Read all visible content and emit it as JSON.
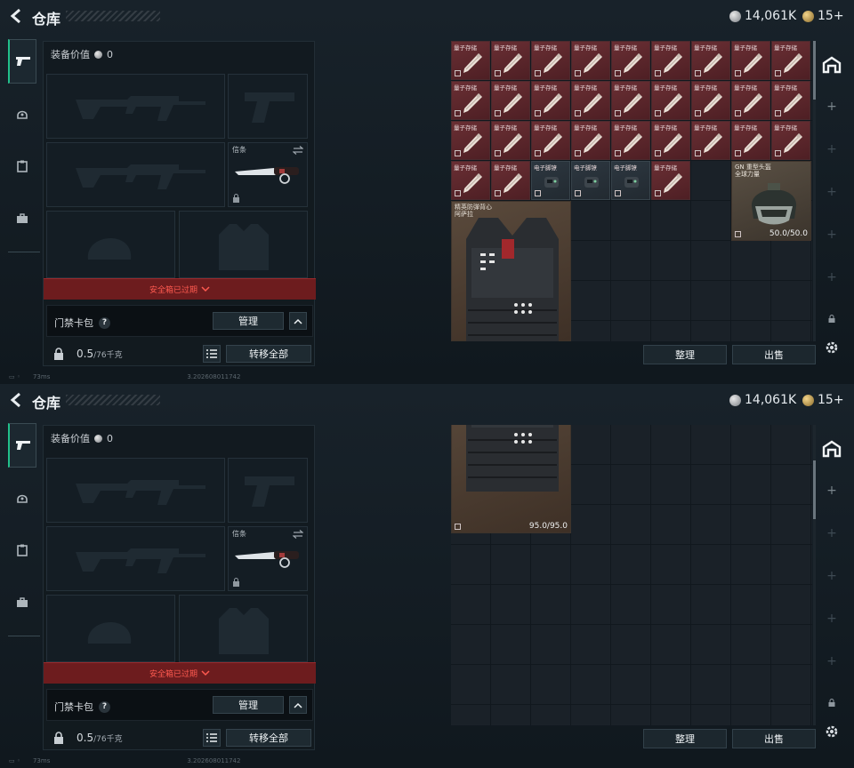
{
  "header": {
    "title": "仓库",
    "silver_amount": "14,061K",
    "gold_amount": "15+"
  },
  "equipment": {
    "value_label": "装备价值",
    "value": "0",
    "knife_label": "信条",
    "safebox_status": "安全箱已过期",
    "card_label": "门禁卡包",
    "manage_label": "管理",
    "weight": "0.5",
    "weight_capacity": "/76千克",
    "transfer_all_label": "转移全部"
  },
  "warehouse": {
    "top_screen": {
      "items": [
        {
          "label": "量子存储",
          "kind": "quantum"
        },
        {
          "label": "量子存储",
          "kind": "quantum"
        },
        {
          "label": "量子存储",
          "kind": "quantum"
        },
        {
          "label": "量子存储",
          "kind": "quantum"
        },
        {
          "label": "量子存储",
          "kind": "quantum"
        },
        {
          "label": "量子存储",
          "kind": "quantum"
        },
        {
          "label": "量子存储",
          "kind": "quantum"
        },
        {
          "label": "量子存储",
          "kind": "quantum"
        },
        {
          "label": "量子存储",
          "kind": "quantum"
        },
        {
          "label": "量子存储",
          "kind": "quantum"
        },
        {
          "label": "量子存储",
          "kind": "quantum"
        },
        {
          "label": "量子存储",
          "kind": "quantum"
        },
        {
          "label": "量子存储",
          "kind": "quantum"
        },
        {
          "label": "量子存储",
          "kind": "quantum"
        },
        {
          "label": "量子存储",
          "kind": "quantum"
        },
        {
          "label": "量子存储",
          "kind": "quantum"
        },
        {
          "label": "量子存储",
          "kind": "quantum"
        },
        {
          "label": "量子存储",
          "kind": "quantum"
        },
        {
          "label": "量子存储",
          "kind": "quantum"
        },
        {
          "label": "量子存储",
          "kind": "quantum"
        },
        {
          "label": "量子存储",
          "kind": "quantum"
        },
        {
          "label": "量子存储",
          "kind": "quantum"
        },
        {
          "label": "量子存储",
          "kind": "quantum"
        },
        {
          "label": "量子存储",
          "kind": "quantum"
        },
        {
          "label": "量子存储",
          "kind": "quantum"
        },
        {
          "label": "量子存储",
          "kind": "quantum"
        },
        {
          "label": "量子存储",
          "kind": "quantum"
        },
        {
          "label": "量子存储",
          "kind": "quantum"
        },
        {
          "label": "量子存储",
          "kind": "quantum"
        },
        {
          "label": "电子脚镣",
          "kind": "anklet"
        },
        {
          "label": "电子脚镣",
          "kind": "anklet"
        },
        {
          "label": "电子脚镣",
          "kind": "anklet"
        },
        {
          "label": "量子存储",
          "kind": "quantum"
        }
      ],
      "helmet_name": "GN 重型头盔",
      "helmet_sub": "全球力量",
      "helmet_durability": "50.0/50.0",
      "vest_name": "精英防弹背心",
      "vest_sub": "阿萨拉"
    },
    "bottom_screen": {
      "vest_durability": "95.0/95.0"
    },
    "sort_label": "整理",
    "sell_label": "出售"
  },
  "footer": {
    "ping": "73ms",
    "build": "3.202608011742"
  },
  "colors": {
    "accent": "#21c08b",
    "expired": "#ff5a50",
    "item_red": "#6a2f34"
  }
}
